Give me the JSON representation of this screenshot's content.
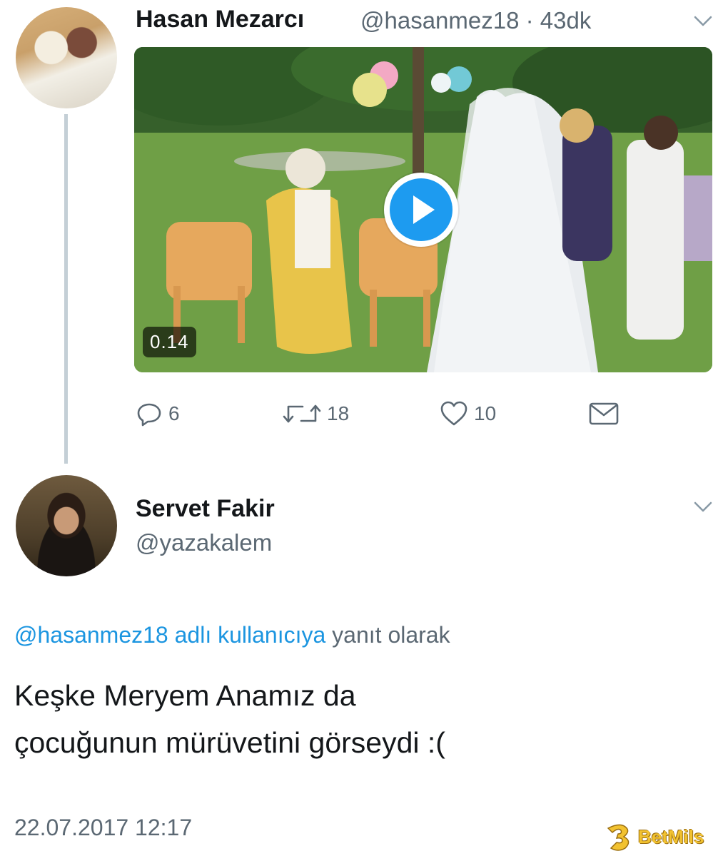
{
  "tweet1": {
    "display_name": "Hasan Mezarcı",
    "handle_time": "@hasanmez18 · 43dk",
    "video_duration": "0.14",
    "actions": {
      "reply_count": "6",
      "retweet_count": "18",
      "like_count": "10"
    }
  },
  "tweet2": {
    "display_name": "Servet Fakir",
    "handle": "@yazakalem",
    "reply_mention": "@hasanmez18 adlı kullanıcıya",
    "reply_suffix": " yanıt olarak",
    "text_line1": "Keşke Meryem Anamız da",
    "text_line2": "çocuğunun mürüvetini görseydi :(",
    "timestamp": "22.07.2017 12:17"
  },
  "watermark": {
    "text": "BetMils"
  },
  "icons": [
    "reply-icon",
    "retweet-icon",
    "like-icon",
    "dm-icon",
    "chevron-down-icon",
    "play-icon"
  ],
  "colors": {
    "link": "#1b95e0",
    "secondary": "#5b6873",
    "play": "#1d9bf0"
  }
}
